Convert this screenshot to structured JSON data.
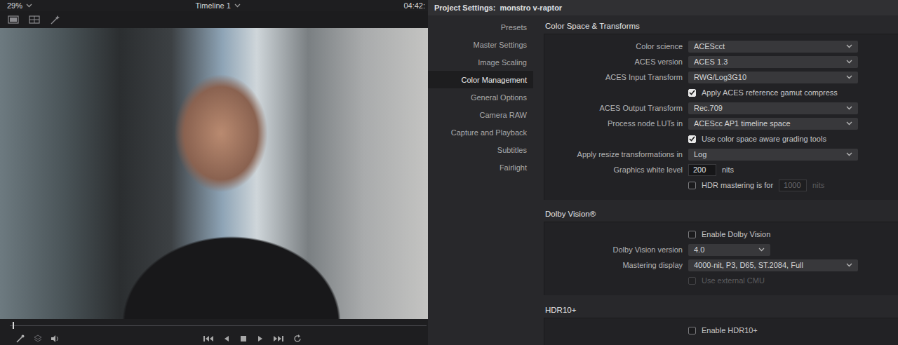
{
  "viewer": {
    "zoom": "29%",
    "timeline": "Timeline 1",
    "timecode": "04:42:"
  },
  "project_settings": {
    "title": "Project Settings:  monstro v-raptor"
  },
  "sidebar": {
    "items": [
      {
        "label": "Presets",
        "selected": false
      },
      {
        "label": "Master Settings",
        "selected": false
      },
      {
        "label": "Image Scaling",
        "selected": false
      },
      {
        "label": "Color Management",
        "selected": true
      },
      {
        "label": "General Options",
        "selected": false
      },
      {
        "label": "Camera RAW",
        "selected": false
      },
      {
        "label": "Capture and Playback",
        "selected": false
      },
      {
        "label": "Subtitles",
        "selected": false
      },
      {
        "label": "Fairlight",
        "selected": false
      }
    ]
  },
  "sections": [
    {
      "title": "Color Space & Transforms",
      "rows": [
        {
          "kind": "dropdown",
          "label": "Color science",
          "value": "ACEScct"
        },
        {
          "kind": "dropdown",
          "label": "ACES version",
          "value": "ACES 1.3"
        },
        {
          "kind": "dropdown",
          "label": "ACES Input Transform",
          "value": "RWG/Log3G10"
        },
        {
          "kind": "checkbox",
          "label": "Apply ACES reference gamut compress",
          "checked": true,
          "disabled": false
        },
        {
          "kind": "dropdown",
          "label": "ACES Output Transform",
          "value": "Rec.709"
        },
        {
          "kind": "dropdown",
          "label": "Process node LUTs in",
          "value": "ACEScc AP1 timeline space"
        },
        {
          "kind": "checkbox",
          "label": "Use color space aware grading tools",
          "checked": true,
          "disabled": false
        },
        {
          "kind": "dropdown",
          "label": "Apply resize transformations in",
          "value": "Log"
        },
        {
          "kind": "number",
          "label": "Graphics white level",
          "value": "200",
          "unit": "nits"
        },
        {
          "kind": "checknumber",
          "label": "HDR mastering is for",
          "checked": false,
          "value": "1000",
          "value_disabled": true,
          "unit": "nits"
        }
      ]
    },
    {
      "title": "Dolby Vision®",
      "rows": [
        {
          "kind": "checkbox",
          "label": "Enable Dolby Vision",
          "checked": false,
          "disabled": false
        },
        {
          "kind": "shortdropdown",
          "label": "Dolby Vision version",
          "value": "4.0"
        },
        {
          "kind": "dropdown",
          "label": "Mastering display",
          "value": "4000-nit, P3, D65, ST.2084, Full"
        },
        {
          "kind": "checkbox",
          "label": "Use external CMU",
          "checked": false,
          "disabled": true
        }
      ]
    },
    {
      "title": "HDR10+",
      "rows": [
        {
          "kind": "checkbox",
          "label": "Enable HDR10+",
          "checked": false,
          "disabled": false
        }
      ]
    }
  ]
}
